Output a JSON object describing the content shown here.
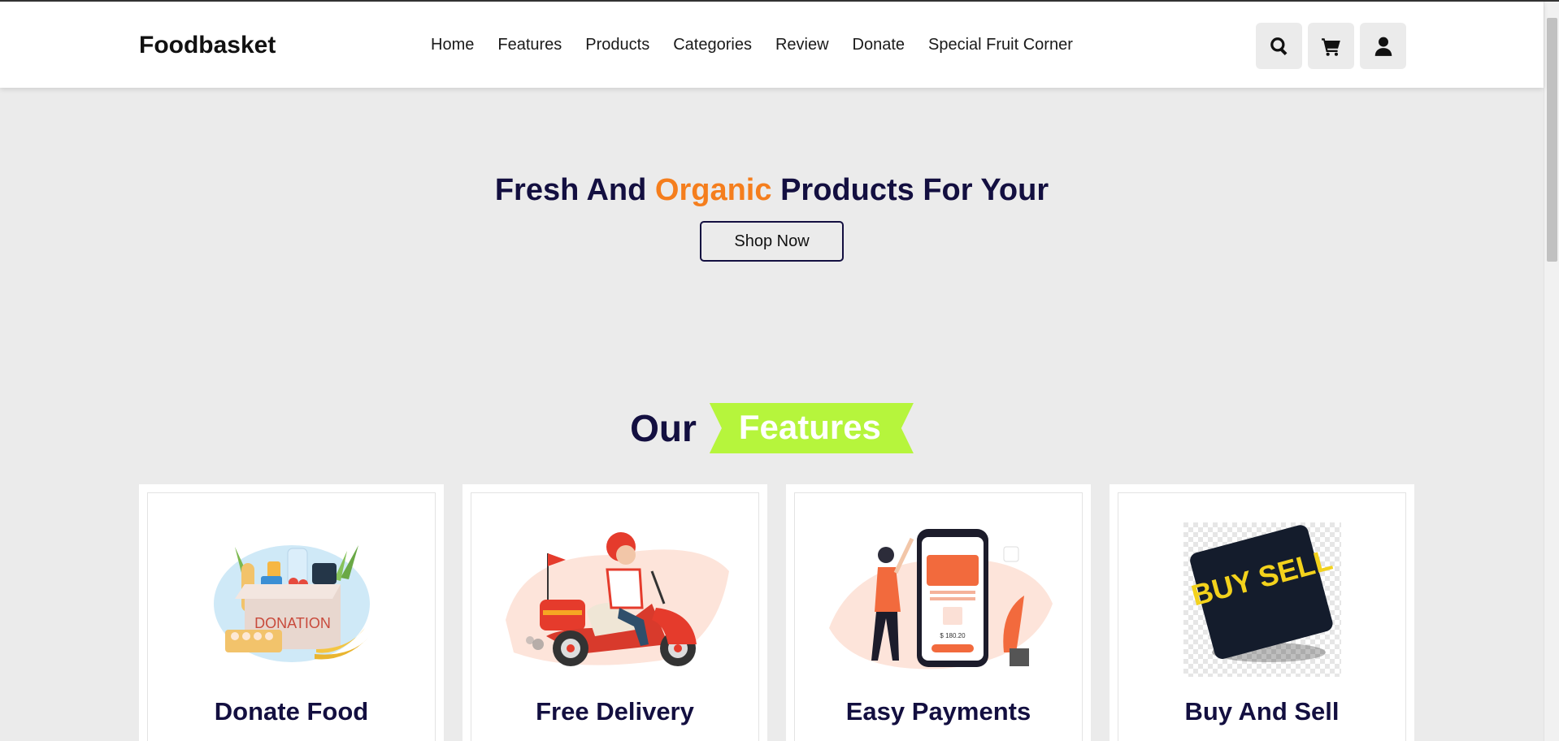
{
  "header": {
    "logo": "Foodbasket",
    "nav": [
      "Home",
      "Features",
      "Products",
      "Categories",
      "Review",
      "Donate",
      "Special Fruit Corner"
    ],
    "icons": [
      "search-icon",
      "cart-icon",
      "user-icon"
    ]
  },
  "hero": {
    "title_before": "Fresh And ",
    "title_accent": "Organic",
    "title_after": " Products For Your",
    "button": "Shop Now"
  },
  "features": {
    "heading_plain": "Our",
    "heading_highlight": "Features",
    "cards": [
      {
        "title": "Donate Food",
        "image": "donation-box-illustration",
        "image_text": "DONATION"
      },
      {
        "title": "Free Delivery",
        "image": "scooter-delivery-illustration"
      },
      {
        "title": "Easy Payments",
        "image": "phone-payment-illustration",
        "image_text": "$ 180.20"
      },
      {
        "title": "Buy And Sell",
        "image": "buy-sell-tile-illustration",
        "image_text": "BUY SELL"
      }
    ]
  },
  "colors": {
    "accent": "#f57e1d",
    "navy": "#130f40",
    "ribbon": "#b6f53c",
    "background": "#ebebeb"
  }
}
